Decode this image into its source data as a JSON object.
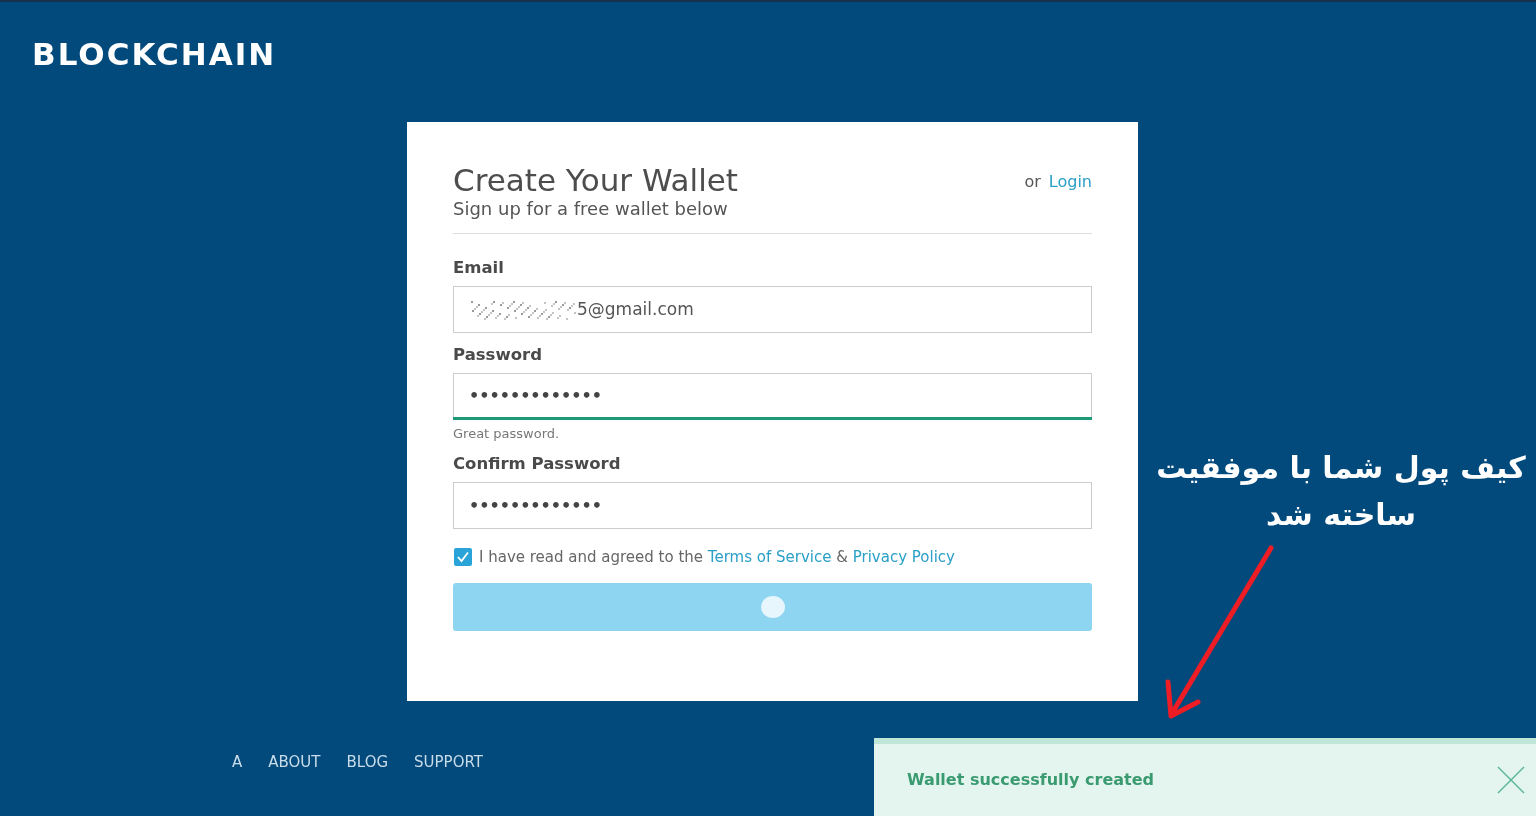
{
  "header": {
    "logo": "BLOCKCHAIN"
  },
  "form": {
    "title": "Create Your Wallet",
    "subtitle": "Sign up for a free wallet below",
    "alt_prefix": "or",
    "alt_link": "Login",
    "fields": [
      {
        "kind": "text",
        "label": "Email",
        "value": "5@gmail.com",
        "redacted": true
      },
      {
        "kind": "password",
        "label": "Password",
        "value": "•••••••••••••",
        "strength": {
          "level": 1,
          "hint": "Great password."
        }
      },
      {
        "kind": "password",
        "label": "Confirm Password",
        "value": "•••••••••••••"
      }
    ],
    "agreement": {
      "checked": true,
      "text": "I have read and agreed to the",
      "links": [
        "Terms of Service",
        "Privacy Policy"
      ],
      "joiner": "&"
    },
    "submit": {
      "loading": true
    }
  },
  "footer": {
    "links": [
      "A",
      "ABOUT",
      "BLOG",
      "SUPPORT"
    ]
  },
  "annotation": {
    "text": "کیف پول شما با موفقیت ساخته شد"
  },
  "toast": {
    "message": "Wallet successfully created"
  }
}
